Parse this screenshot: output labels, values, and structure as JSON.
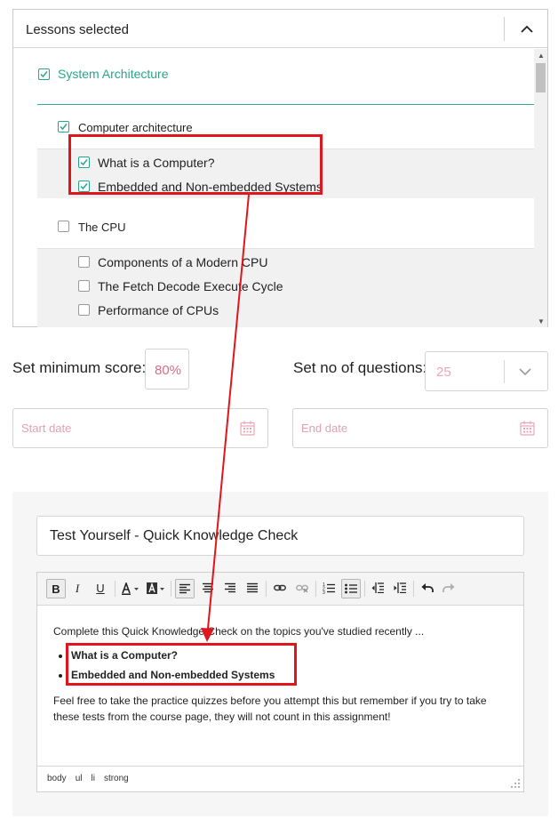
{
  "lessons": {
    "title": "Lessons selected",
    "toggle_icon": "chevron-up-icon",
    "group": {
      "label": "System Architecture",
      "checked": true
    },
    "topics": [
      {
        "label": "Computer architecture",
        "checked": true,
        "items": [
          {
            "label": "What is a Computer?",
            "checked": true
          },
          {
            "label": "Embedded and Non-embedded Systems",
            "checked": true
          }
        ]
      },
      {
        "label": "The CPU",
        "checked": false,
        "items": [
          {
            "label": "Components of a Modern CPU",
            "checked": false
          },
          {
            "label": "The Fetch Decode Execute Cycle",
            "checked": false
          },
          {
            "label": "Performance of CPUs",
            "checked": false
          }
        ]
      }
    ]
  },
  "settings": {
    "min_score_label": "Set minimum score:",
    "min_score_value": "80%",
    "num_questions_label": "Set no of questions:",
    "num_questions_value": "25",
    "start_date_placeholder": "Start date",
    "end_date_placeholder": "End date"
  },
  "assignment": {
    "title_value": "Test Yourself - Quick Knowledge Check",
    "toolbar": [
      "bold",
      "italic",
      "underline",
      "text-color",
      "background-color",
      "align-left",
      "align-center",
      "align-right",
      "justify",
      "link",
      "unlink",
      "numbered-list",
      "bullet-list",
      "outdent",
      "indent",
      "undo",
      "redo"
    ],
    "toolbar_labels": {
      "bold": "B",
      "italic": "I",
      "underline": "U"
    },
    "body_intro": "Complete this Quick Knowledge Check on the topics you've studied recently ...",
    "body_list": [
      "What is a Computer?",
      "Embedded and Non-embedded Systems"
    ],
    "body_outro": "Feel free to take the practice quizzes before you attempt this but remember if you try to take these tests from the course page, they will not count in this assignment!",
    "status_path": [
      "body",
      "ul",
      "li",
      "strong"
    ]
  },
  "colors": {
    "accent_green": "#2aa58c",
    "placeholder_pink": "#e0a1b1",
    "score_pink": "#d96c84",
    "annotation_red": "#e0161c"
  }
}
